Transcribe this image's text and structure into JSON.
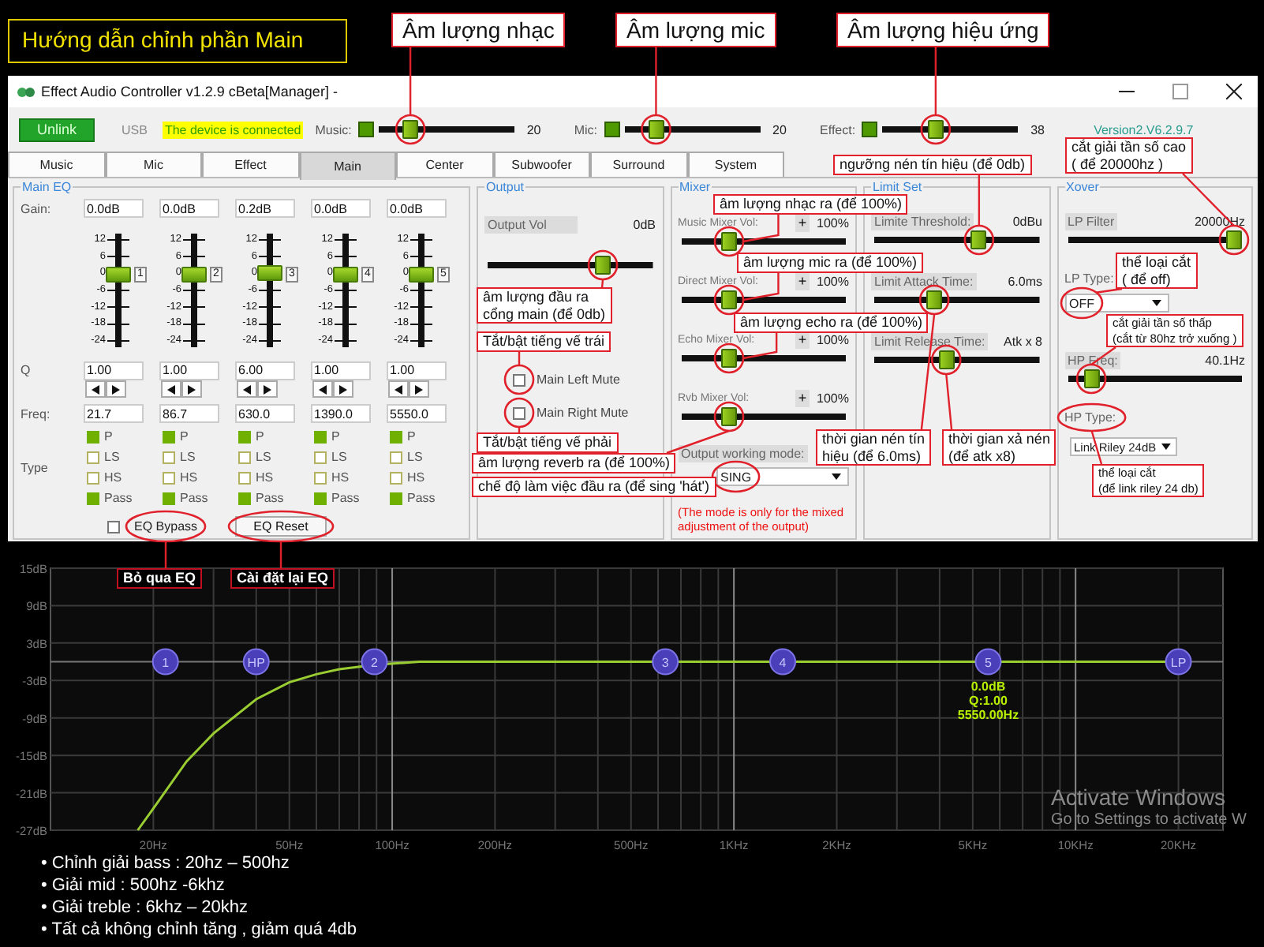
{
  "guide_title": "Hướng dẫn chỉnh phần Main",
  "window": {
    "title": "Effect Audio Controller  v1.2.9 cBeta[Manager] -"
  },
  "toolbar": {
    "link_button": "Unlink",
    "interface": "USB",
    "status": "The device is connected",
    "version": "Version2.V6.2.9.7",
    "sliders": [
      {
        "label": "Music:",
        "level": 0.2,
        "reading": "20"
      },
      {
        "label": "Mic:",
        "level": 0.2,
        "reading": "20"
      },
      {
        "label": "Effect:",
        "level": 0.38,
        "reading": "38"
      }
    ]
  },
  "tabs": [
    {
      "label": "Music",
      "selected": false
    },
    {
      "label": "Mic",
      "selected": false
    },
    {
      "label": "Effect",
      "selected": false
    },
    {
      "label": "Main",
      "selected": true
    },
    {
      "label": "Center",
      "selected": false
    },
    {
      "label": "Subwoofer",
      "selected": false
    },
    {
      "label": "Surround",
      "selected": false
    },
    {
      "label": "System",
      "selected": false
    }
  ],
  "main_eq": {
    "title": "Main EQ",
    "gain_label": "Gain:",
    "q_label": "Q",
    "freq_label": "Freq:",
    "type_label": "Type",
    "bands": [
      {
        "gain": "0.0dB",
        "level": 0.667,
        "scale": [
          "12",
          "6",
          "0",
          "-6",
          "-12",
          "-18",
          "-24"
        ],
        "number": "1",
        "q": "1.00",
        "freq": "21.7",
        "types": [
          {
            "label": "P",
            "checked": true
          },
          {
            "label": "LS",
            "checked": false
          },
          {
            "label": "HS",
            "checked": false
          },
          {
            "label": "Pass",
            "checked": true
          }
        ]
      },
      {
        "gain": "0.0dB",
        "level": 0.667,
        "scale": [
          "12",
          "6",
          "0",
          "-6",
          "-12",
          "-18",
          "-24"
        ],
        "number": "2",
        "q": "1.00",
        "freq": "86.7",
        "types": [
          {
            "label": "P",
            "checked": true
          },
          {
            "label": "LS",
            "checked": false
          },
          {
            "label": "HS",
            "checked": false
          },
          {
            "label": "Pass",
            "checked": true
          }
        ]
      },
      {
        "gain": "0.2dB",
        "level": 0.672,
        "scale": [
          "12",
          "6",
          "0",
          "-6",
          "-12",
          "-18",
          "-24"
        ],
        "number": "3",
        "q": "6.00",
        "freq": "630.0",
        "types": [
          {
            "label": "P",
            "checked": true
          },
          {
            "label": "LS",
            "checked": false
          },
          {
            "label": "HS",
            "checked": false
          },
          {
            "label": "Pass",
            "checked": true
          }
        ]
      },
      {
        "gain": "0.0dB",
        "level": 0.667,
        "scale": [
          "12",
          "6",
          "0",
          "-6",
          "-12",
          "-18",
          "-24"
        ],
        "number": "4",
        "q": "1.00",
        "freq": "1390.0",
        "types": [
          {
            "label": "P",
            "checked": true
          },
          {
            "label": "LS",
            "checked": false
          },
          {
            "label": "HS",
            "checked": false
          },
          {
            "label": "Pass",
            "checked": true
          }
        ]
      },
      {
        "gain": "0.0dB",
        "level": 0.667,
        "scale": [
          "12",
          "6",
          "0",
          "-6",
          "-12",
          "-18",
          "-24"
        ],
        "number": "5",
        "q": "1.00",
        "freq": "5550.0",
        "types": [
          {
            "label": "P",
            "checked": true
          },
          {
            "label": "LS",
            "checked": false
          },
          {
            "label": "HS",
            "checked": false
          },
          {
            "label": "Pass",
            "checked": true
          }
        ]
      }
    ],
    "bypass": {
      "label": "EQ Bypass",
      "checked": false
    },
    "reset": "EQ Reset"
  },
  "output": {
    "title": "Output",
    "vol_label": "Output Vol",
    "reading": "0dB",
    "level": 0.72,
    "mutes": [
      {
        "label": "Main Left Mute",
        "checked": false
      },
      {
        "label": "Main Right Mute",
        "checked": false
      }
    ]
  },
  "mixer": {
    "title": "Mixer",
    "channels": [
      {
        "label": "Music Mixer Vol:",
        "plus": "+",
        "reading": "100%",
        "level": 0.27
      },
      {
        "label": "Direct Mixer Vol:",
        "plus": "+",
        "reading": "100%",
        "level": 0.27
      },
      {
        "label": "Echo Mixer Vol:",
        "plus": "+",
        "reading": "100%",
        "level": 0.27
      },
      {
        "label": "Rvb Mixer Vol:",
        "plus": "+",
        "reading": "100%",
        "level": 0.27
      }
    ],
    "mode_label": "Output working mode:",
    "mode": "SING",
    "note": "(The mode is only for the mixed adjustment of the output)"
  },
  "limit_set": {
    "title": "Limit Set",
    "controls": [
      {
        "label": "Limite Threshold:",
        "reading": "0dBu",
        "level": 0.65
      },
      {
        "label": "Limit Attack Time:",
        "reading": "6.0ms",
        "level": 0.35
      },
      {
        "label": "Limit Release Time:",
        "reading": "Atk x 8",
        "level": 0.43
      }
    ]
  },
  "xover": {
    "title": "Xover",
    "lp_filter": {
      "label": "LP Filter",
      "reading": "20000Hz",
      "level": 1.0
    },
    "lp_type": {
      "label": "LP Type:",
      "value": "OFF"
    },
    "hp_freq": {
      "label": "HP Freq:",
      "reading": "40.1Hz",
      "level": 0.1
    },
    "hp_type": {
      "label": "HP Type:",
      "value": "Link Riley 24dB"
    }
  },
  "callouts": [
    {
      "kind": "title",
      "text": "Âm lượng nhạc"
    },
    {
      "kind": "title",
      "text": "Âm lượng mic"
    },
    {
      "kind": "title",
      "text": "Âm lượng hiệu ứng"
    },
    {
      "kind": "light",
      "text": "ngưỡng nén tín hiệu (để 0db)"
    },
    {
      "kind": "light",
      "text": "cắt giải tần số cao\n( để 20000hz )"
    },
    {
      "kind": "light",
      "text": "âm lượng nhạc ra (để 100%)"
    },
    {
      "kind": "light",
      "text": "âm lượng mic ra (để 100%)"
    },
    {
      "kind": "light",
      "text": "âm lượng echo ra (để 100%)"
    },
    {
      "kind": "light",
      "text": "thể loại cắt\n( để off)"
    },
    {
      "kind": "small",
      "text": "cắt giải tần số thấp\n(cắt từ 80hz trở xuống )"
    },
    {
      "kind": "light",
      "text": "âm lượng đầu ra\ncổng main (để 0db)"
    },
    {
      "kind": "light",
      "text": "Tắt/bật tiếng vế trái"
    },
    {
      "kind": "light",
      "text": "Tắt/bật tiếng vế phải"
    },
    {
      "kind": "light",
      "text": "âm lượng reverb ra (để 100%)"
    },
    {
      "kind": "light",
      "text": "chế độ làm việc đầu ra (để sing 'hát')"
    },
    {
      "kind": "light",
      "text": "thời gian nén tín\nhiệu (để 6.0ms)"
    },
    {
      "kind": "light",
      "text": "thời gian xả nén\n(để atk x8)"
    },
    {
      "kind": "small",
      "text": "thể loại cắt\n(để link riley 24 db)"
    },
    {
      "kind": "dark",
      "text": "Bỏ qua EQ"
    },
    {
      "kind": "dark",
      "text": "Cài đặt lại EQ"
    }
  ],
  "chart": {
    "y_labels": [
      "15dB",
      "9dB",
      "3dB",
      "-3dB",
      "-9dB",
      "-15dB",
      "-21dB",
      "-27dB"
    ],
    "x_labels": [
      "20Hz",
      "50Hz",
      "100Hz",
      "200Hz",
      "500Hz",
      "1KHz",
      "2KHz",
      "5KHz",
      "10KHz",
      "20KHz"
    ],
    "handles": [
      "1",
      "HP",
      "2",
      "3",
      "4",
      "5",
      "LP"
    ],
    "readout": [
      "0.0dB",
      "Q:1.00",
      "5550.00Hz"
    ]
  },
  "os_notice": [
    "Activate Windows",
    "Go to Settings to activate W"
  ],
  "notes": [
    "• Chỉnh giải bass : 20hz – 500hz",
    "• Giải mid : 500hz -6khz",
    "• Giải treble : 6khz – 20khz",
    "• Tất cả không chỉnh tăng , giảm quá 4db"
  ]
}
